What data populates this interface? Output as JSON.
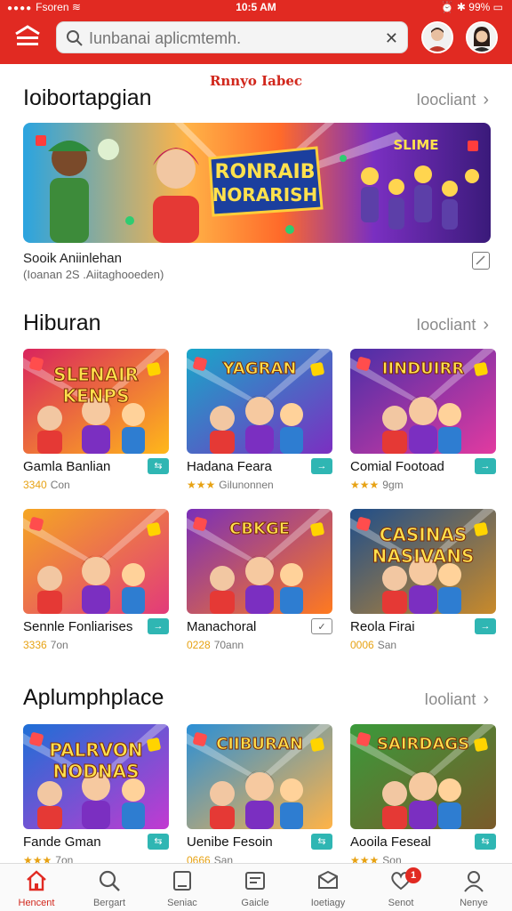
{
  "status_bar": {
    "carrier": "Fsoren",
    "time": "10:5 AM",
    "battery": "99%"
  },
  "header": {
    "search_placeholder": "Iunbanai aplicmtemh."
  },
  "subtitle": "Rnnyo Iabec",
  "sections": [
    {
      "title": "Ioibortapgian",
      "see_all": "Ioocliant",
      "banner": {
        "art_title_line1": "RONRAIB",
        "art_title_line2": "NORARISH",
        "art_badge": "SLIME",
        "caption": "Sooik Aniinlehan",
        "subcaption": "(Ioanan 2S .Aiitaghooeden)"
      }
    },
    {
      "title": "Hiburan",
      "see_all": "Ioocliant",
      "cards": [
        {
          "art_line1": "SLENAIR",
          "art_line2": "KENPS",
          "name": "Gamla Banlian",
          "rating": "3340",
          "meta": "Con",
          "action": "⇆",
          "color1": "#d9245e",
          "color2": "#ffb81a"
        },
        {
          "art_line1": "YAGRAN",
          "art_line2": "",
          "name": "Hadana Feara",
          "rating": "★★★",
          "meta": "Gilunonnen",
          "action": "→",
          "color1": "#19a7c9",
          "color2": "#7b2fc1"
        },
        {
          "art_line1": "IINDUIRR",
          "art_line2": "",
          "name": "Comial Footoad",
          "rating": "★★★",
          "meta": "9gm",
          "action": "→",
          "color1": "#4a2fa8",
          "color2": "#e23aa0"
        }
      ]
    },
    {
      "title": "",
      "see_all": "",
      "cards": [
        {
          "art_line1": "",
          "art_line2": "",
          "name": "Sennle Fonliarises",
          "rating": "3336",
          "meta": "7on",
          "action": "→",
          "color1": "#f5a623",
          "color2": "#e23a7a"
        },
        {
          "art_line1": "CBKGE",
          "art_line2": "",
          "name": "Manachoral",
          "rating": "0228",
          "meta": "70ann",
          "action": "✓",
          "color1": "#7a2fb8",
          "color2": "#ff7a1f"
        },
        {
          "art_line1": "CASINAS",
          "art_line2": "NASIVANS",
          "name": "Reola Firai",
          "rating": "0006",
          "meta": "San",
          "action": "→",
          "color1": "#1f4e8a",
          "color2": "#c98a2a"
        }
      ]
    },
    {
      "title": "Aplumphplace",
      "see_all": "Iooliant",
      "cards": [
        {
          "art_line1": "PALRVON",
          "art_line2": "NODNAS",
          "name": "Fande Gman",
          "rating": "★★★",
          "meta": "7on",
          "action": "⇆",
          "color1": "#1d6fd6",
          "color2": "#c23ad1"
        },
        {
          "art_line1": "CIIBURAN",
          "art_line2": "",
          "name": "Uenibe Fesoin",
          "rating": "0666",
          "meta": "San",
          "action": "⇆",
          "color1": "#2a8fd6",
          "color2": "#ffb347"
        },
        {
          "art_line1": "SAIRDAGS",
          "art_line2": "",
          "name": "Aooila Feseal",
          "rating": "★★★",
          "meta": "Son",
          "action": "⇆",
          "color1": "#3a9a3a",
          "color2": "#7a5a2a"
        }
      ]
    }
  ],
  "bottom_nav": [
    {
      "label": "Hencent",
      "icon": "home-icon"
    },
    {
      "label": "Bergart",
      "icon": "search-icon"
    },
    {
      "label": "Seniac",
      "icon": "tablet-icon"
    },
    {
      "label": "Gaicle",
      "icon": "news-icon"
    },
    {
      "label": "Ioetiagy",
      "icon": "inbox-icon"
    },
    {
      "label": "Senot",
      "icon": "heart-icon",
      "badge": "1"
    },
    {
      "label": "Nenye",
      "icon": "user-icon"
    }
  ],
  "colors": {
    "brand": "#e12a22",
    "accent_teal": "#2fb6b3",
    "star": "#e7a213"
  }
}
